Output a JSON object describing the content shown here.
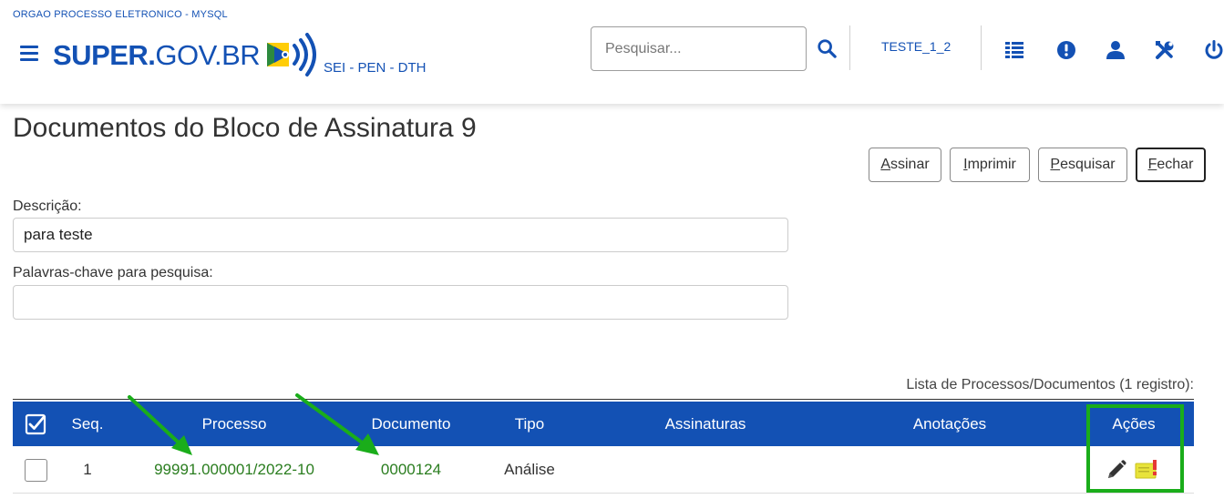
{
  "header": {
    "org_name": "ORGAO PROCESSO ELETRONICO - MYSQL",
    "logo_bold": "SUPER.",
    "logo_light": "GOV.BR",
    "subtitle": "SEI - PEN - DTH",
    "search_placeholder": "Pesquisar...",
    "user_unit": "TESTE_1_2",
    "icons": [
      "menu-icon",
      "search-icon",
      "list-icon",
      "alert-icon",
      "user-icon",
      "tools-icon",
      "power-icon"
    ],
    "brand_color": "#1351b4"
  },
  "page": {
    "title": "Documentos do Bloco de Assinatura 9",
    "buttons": [
      {
        "accesskey": "A",
        "rest": "ssinar"
      },
      {
        "accesskey": "I",
        "rest": "mprimir"
      },
      {
        "accesskey": "P",
        "rest": "esquisar"
      },
      {
        "accesskey": "F",
        "rest": "echar"
      }
    ]
  },
  "form": {
    "descricao_label": "Descrição:",
    "descricao_value": "para teste",
    "palavras_label": "Palavras-chave para pesquisa:",
    "palavras_value": ""
  },
  "table": {
    "caption": "Lista de Processos/Documentos (1 registro):",
    "header_color": "#1351b4",
    "columns": [
      "Seq.",
      "Processo",
      "Documento",
      "Tipo",
      "Assinaturas",
      "Anotações",
      "Ações"
    ],
    "rows": [
      {
        "seq": "1",
        "processo": "99991.000001/2022-10",
        "documento": "0000124",
        "tipo": "Análise",
        "assinaturas": "",
        "anotacoes": "",
        "acoes": [
          "edit-pencil-icon",
          "annotation-note-icon"
        ]
      }
    ]
  },
  "annotation_color": "#1aad1a"
}
